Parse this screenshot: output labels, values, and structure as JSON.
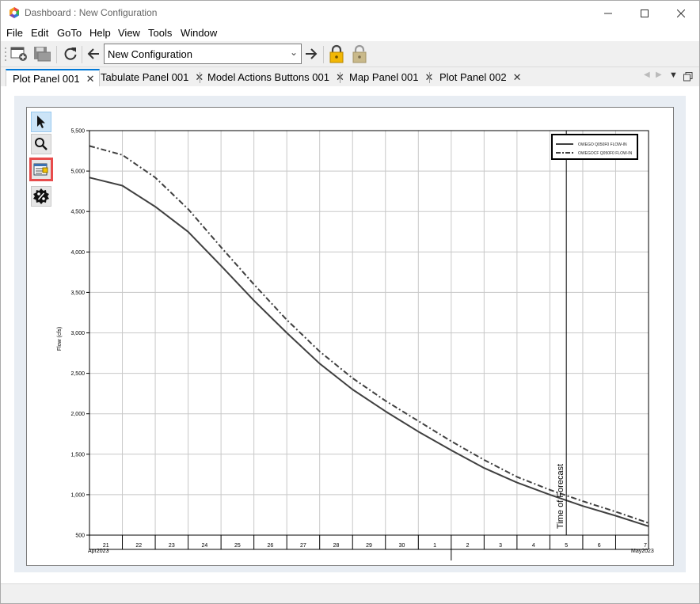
{
  "window": {
    "title": "Dashboard : New Configuration"
  },
  "menu": [
    "File",
    "Edit",
    "GoTo",
    "Help",
    "View",
    "Tools",
    "Window"
  ],
  "toolbar": {
    "configuration": "New Configuration"
  },
  "tabs": [
    {
      "label": "Plot Panel 001",
      "active": true
    },
    {
      "label": "Tabulate Panel 001",
      "active": false
    },
    {
      "label": "Model Actions Buttons 001",
      "active": false
    },
    {
      "label": "Map Panel 001",
      "active": false
    },
    {
      "label": "Plot Panel 002",
      "active": false
    }
  ],
  "colors": {
    "accent": "#0078d7",
    "highlight": "#e84c4c",
    "series": "#404040"
  },
  "chart_data": {
    "type": "line",
    "ylabel": "Flow (cfs)",
    "ylim": [
      500,
      5500
    ],
    "yticks": [
      "5,500",
      "5,000",
      "4,500",
      "4,000",
      "3,500",
      "3,000",
      "2,500",
      "2,000",
      "1,500",
      "1,000",
      "500"
    ],
    "xticks": [
      "21",
      "22",
      "23",
      "24",
      "25",
      "26",
      "27",
      "28",
      "29",
      "30",
      "1",
      "2",
      "3",
      "4",
      "5",
      "6",
      "7"
    ],
    "x_month_start": "Apr2023",
    "x_month_end": "May2023",
    "forecast_marker": {
      "label": "Time of Forecast",
      "x": "2023-05-04 12:00"
    },
    "grid": true,
    "legend_position": "top-right",
    "series": [
      {
        "name": "OWEGO Q050F0 FLOW-IN",
        "style": "solid",
        "x": [
          "2023-04-20",
          "2023-04-21",
          "2023-04-22",
          "2023-04-23",
          "2023-04-24",
          "2023-04-25",
          "2023-04-26",
          "2023-04-27",
          "2023-04-28",
          "2023-04-29",
          "2023-04-30",
          "2023-05-01",
          "2023-05-02",
          "2023-05-03",
          "2023-05-04",
          "2023-05-05",
          "2023-05-06",
          "2023-05-07"
        ],
        "values": [
          4920,
          4820,
          4560,
          4250,
          3830,
          3400,
          3000,
          2620,
          2300,
          2030,
          1780,
          1550,
          1330,
          1150,
          1000,
          860,
          740,
          610
        ]
      },
      {
        "name": "OWEGOCF Q050F0 FLOW-IN",
        "style": "dash-dot",
        "x": [
          "2023-04-20",
          "2023-04-21",
          "2023-04-22",
          "2023-04-23",
          "2023-04-24",
          "2023-04-25",
          "2023-04-26",
          "2023-04-27",
          "2023-04-28",
          "2023-04-29",
          "2023-04-30",
          "2023-05-01",
          "2023-05-02",
          "2023-05-03",
          "2023-05-04",
          "2023-05-05",
          "2023-05-06",
          "2023-05-07"
        ],
        "values": [
          5310,
          5200,
          4920,
          4530,
          4060,
          3600,
          3160,
          2770,
          2440,
          2160,
          1910,
          1660,
          1430,
          1220,
          1060,
          920,
          790,
          650
        ]
      }
    ]
  }
}
